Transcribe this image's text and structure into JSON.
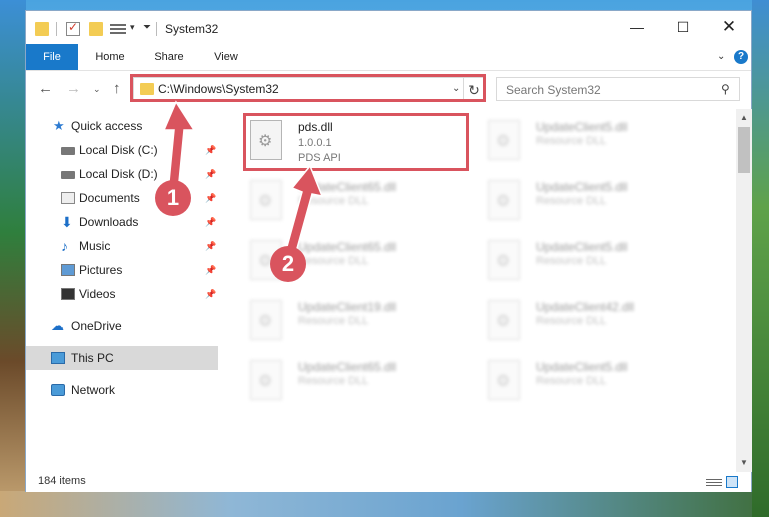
{
  "window": {
    "title": "System32"
  },
  "ribbon": {
    "tabs": [
      "File",
      "Home",
      "Share",
      "View"
    ]
  },
  "address": {
    "path": "C:\\Windows\\System32"
  },
  "search": {
    "placeholder": "Search System32"
  },
  "sidebar": {
    "items": [
      {
        "label": "Quick access",
        "icon": "star-icon",
        "pinned": false
      },
      {
        "label": "Local Disk (C:)",
        "icon": "disk-icon",
        "pinned": true
      },
      {
        "label": "Local Disk (D:)",
        "icon": "disk-icon",
        "pinned": true
      },
      {
        "label": "Documents",
        "icon": "documents-icon",
        "pinned": true
      },
      {
        "label": "Downloads",
        "icon": "download-icon",
        "pinned": true
      },
      {
        "label": "Music",
        "icon": "music-icon",
        "pinned": true
      },
      {
        "label": "Pictures",
        "icon": "pictures-icon",
        "pinned": true
      },
      {
        "label": "Videos",
        "icon": "videos-icon",
        "pinned": true
      },
      {
        "label": "OneDrive",
        "icon": "cloud-icon",
        "pinned": false
      },
      {
        "label": "This PC",
        "icon": "pc-icon",
        "pinned": false,
        "selected": true
      },
      {
        "label": "Network",
        "icon": "network-icon",
        "pinned": false
      }
    ]
  },
  "files": [
    {
      "name": "pds.dll",
      "version": "1.0.0.1",
      "description": "PDS API"
    },
    {
      "name": "UpdateClient5.dll",
      "description": "Resource DLL"
    },
    {
      "name": "UpdateClient65.dll",
      "description": "Resource DLL"
    },
    {
      "name": "UpdateClient5.dll",
      "description": "Resource DLL"
    },
    {
      "name": "UpdateClient65.dll",
      "description": "Resource DLL"
    },
    {
      "name": "UpdateClient5.dll",
      "description": "Resource DLL"
    },
    {
      "name": "UpdateClient19.dll",
      "description": "Resource DLL"
    },
    {
      "name": "UpdateClient42.dll",
      "description": "Resource DLL"
    },
    {
      "name": "UpdateClient65.dll",
      "description": "Resource DLL"
    },
    {
      "name": "UpdateClient5.dll",
      "description": "Resource DLL"
    }
  ],
  "status": {
    "item_count": "184 items"
  },
  "annotations": {
    "step1": "1",
    "step2": "2",
    "color": "#d9545e"
  }
}
